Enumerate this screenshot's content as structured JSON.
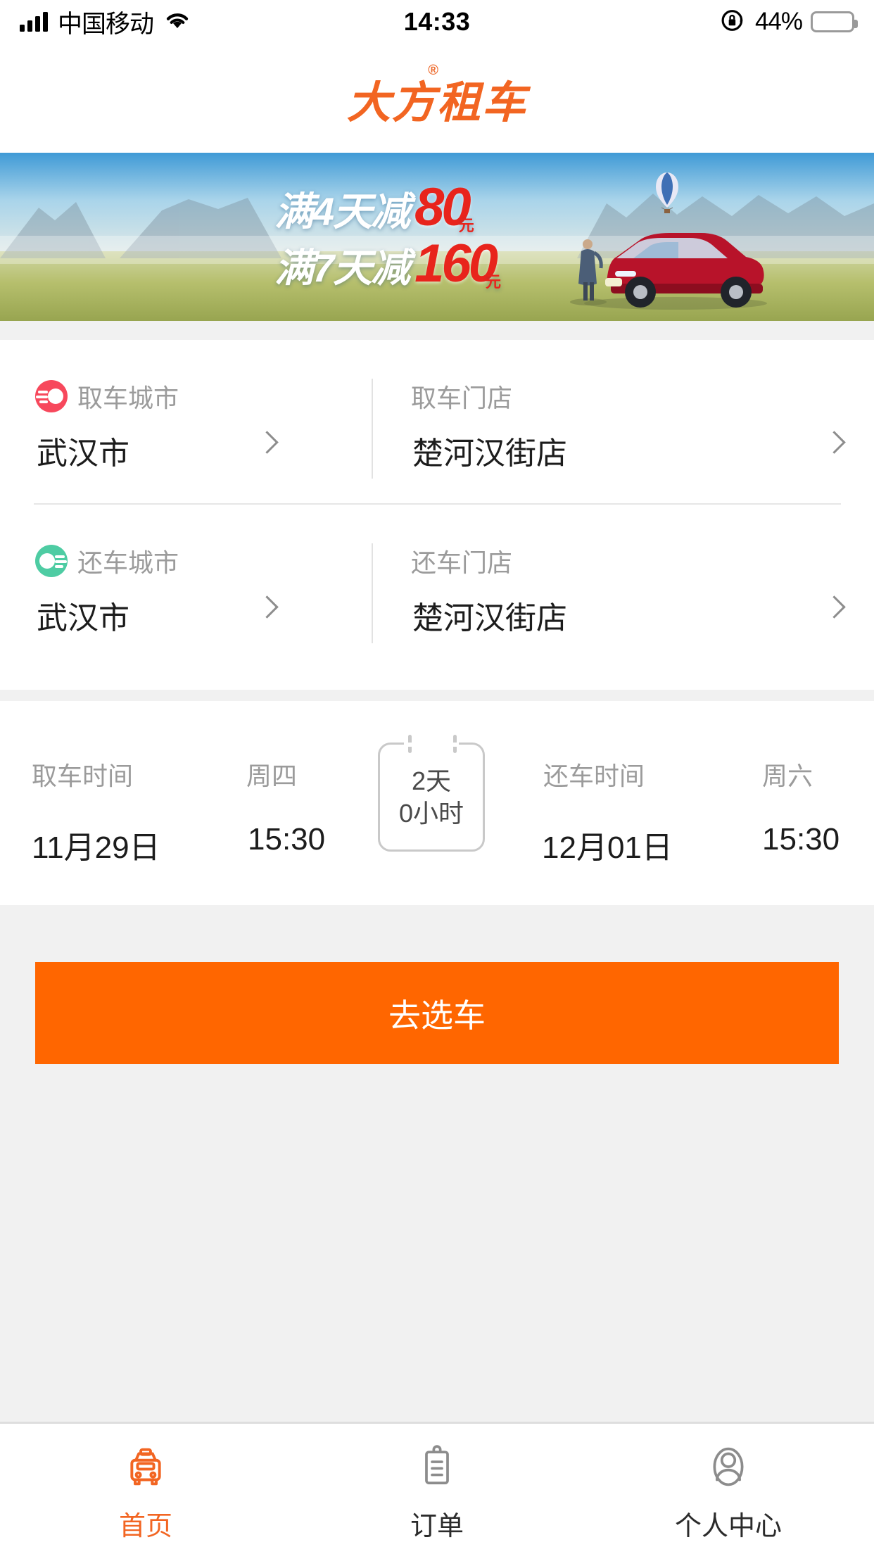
{
  "status_bar": {
    "carrier": "中国移动",
    "time": "14:33",
    "battery_pct": "44%",
    "battery_level": 44,
    "signal_icon": "signal-bars-icon",
    "wifi_icon": "wifi-icon",
    "rotation_lock_icon": "rotation-lock-icon",
    "battery_icon": "battery-icon",
    "battery_color": "#FFCC00"
  },
  "header": {
    "logo_text": "大方租车",
    "registered_mark": "®",
    "brand_color": "#F26522"
  },
  "banner": {
    "line1_cn": "满4天减",
    "line1_num": "80",
    "line1_unit": "元",
    "line2_cn": "满7天减",
    "line2_num": "160",
    "line2_unit": "元",
    "num_color": "#E8241C",
    "text_color": "#FFFFFF",
    "alt": "促销横幅 草原山景 红色SUV 热气球"
  },
  "location": {
    "pickup": {
      "city_label": "取车城市",
      "city_value": "武汉市",
      "store_label": "取车门店",
      "store_value": "楚河汉街店",
      "icon": "pickup-car-icon",
      "icon_color": "#F7485C",
      "chevron_icon": "chevron-right-icon"
    },
    "return": {
      "city_label": "还车城市",
      "city_value": "武汉市",
      "store_label": "还车门店",
      "store_value": "楚河汉街店",
      "icon": "return-car-icon",
      "icon_color": "#4ECCA3",
      "chevron_icon": "chevron-right-icon"
    }
  },
  "time": {
    "pickup": {
      "label": "取车时间",
      "weekday": "周四",
      "date": "11月29日",
      "time": "15:30"
    },
    "return": {
      "label": "还车时间",
      "weekday": "周六",
      "date": "12月01日",
      "time": "15:30"
    },
    "duration": {
      "days": "2天",
      "hours": "0小时"
    }
  },
  "cta": {
    "label": "去选车",
    "color": "#FF6600"
  },
  "tabbar": {
    "items": [
      {
        "label": "首页",
        "icon": "car-icon",
        "active": true
      },
      {
        "label": "订单",
        "icon": "clipboard-icon",
        "active": false
      },
      {
        "label": "个人中心",
        "icon": "person-icon",
        "active": false
      }
    ],
    "active_color": "#F26522",
    "inactive_color": "#8c8c8c"
  }
}
